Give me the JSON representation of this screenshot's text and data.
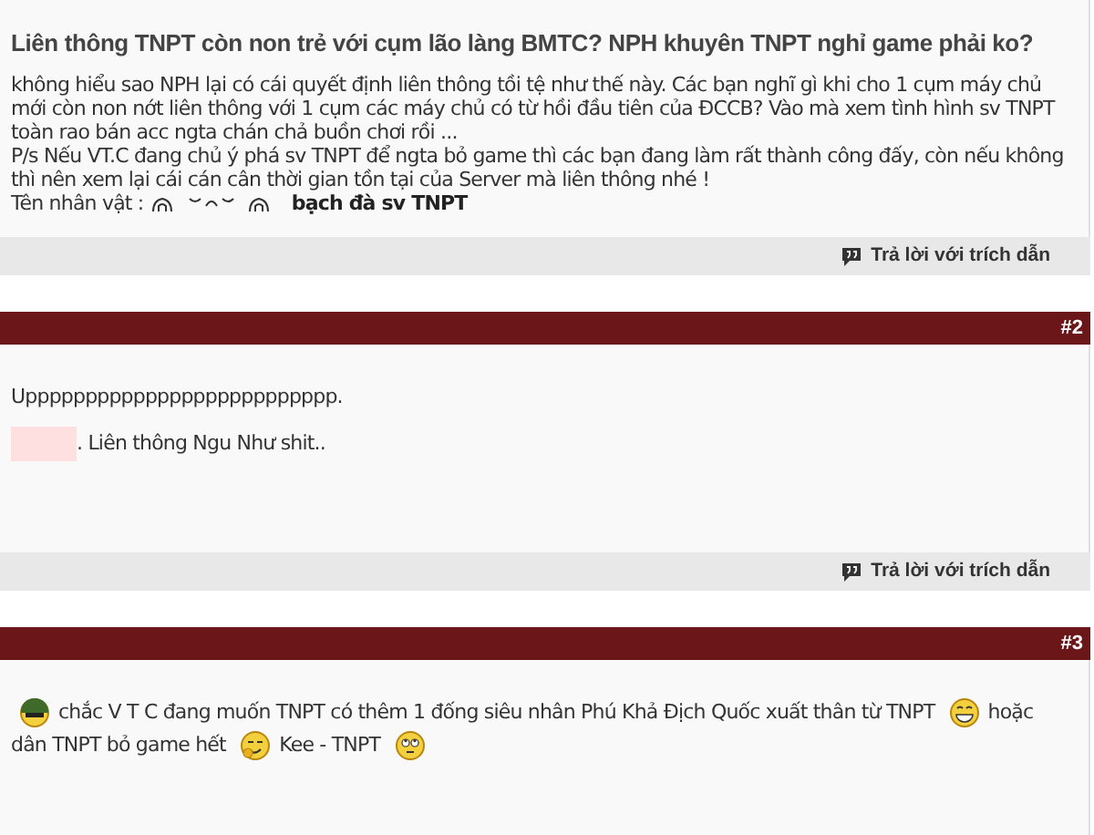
{
  "posts": [
    {
      "title": "Liên thông TNPT còn non trẻ với cụm lão làng BMTC? NPH khuyên TNPT nghỉ game phải ko?",
      "paragraphs": [
        {
          "segments": [
            {
              "kind": "text",
              "text": "không hiểu sao NPH lại có cái quyết định liên thông tồi tệ như thế này. Các bạn nghĩ gì khi cho 1 cụm máy chủ mới còn non nớt liên thông với 1 cụm các máy chủ có từ hồi đầu tiên của ĐCCB? Vào mà xem tình hình sv TNPT toàn rao bán acc ngta chán chả buồn chơi rồi ..."
            }
          ]
        },
        {
          "segments": [
            {
              "kind": "text",
              "text": "P/s Nếu VT.C đang chủ ý phá sv TNPT để ngta bỏ game thì các bạn đang làm rất thành công đấy, còn nếu không thì nên xem lại cái cán cân thời gian tồn tại của Server mà liên thông nhé !"
            }
          ]
        },
        {
          "segments": [
            {
              "kind": "text",
              "text": "Tên nhân vật :"
            },
            {
              "kind": "kaomoji"
            },
            {
              "kind": "bold",
              "text": "bạch đà sv TNPT"
            }
          ]
        }
      ],
      "reply_label": "Trả lời với trích dẫn"
    },
    {
      "number": "#2",
      "paragraphs": [
        {
          "segments": [
            {
              "kind": "text",
              "text": "Upppppppppppppppppppppppppp."
            }
          ]
        },
        {
          "segments": [
            {
              "kind": "redacted"
            },
            {
              "kind": "text",
              "text": ". Liên thông Ngu Như shit.."
            }
          ]
        }
      ],
      "reply_label": "Trả lời với trích dẫn"
    },
    {
      "number": "#3",
      "paragraphs": [
        {
          "segments": [
            {
              "kind": "helmet"
            },
            {
              "kind": "phrase",
              "text": "chắc V T C đang muốn TNPT có thêm 1 đống siêu nhân Phú Khả Địch Quốc xuất thân từ TNPT"
            },
            {
              "kind": "grin"
            },
            {
              "kind": "phrase",
              "text": "hoặc"
            },
            {
              "kind": "phrase",
              "text": "dân TNPT bỏ game hết"
            },
            {
              "kind": "giggle"
            },
            {
              "kind": "phrase",
              "text": "Kee - TNPT"
            },
            {
              "kind": "rolleyes"
            }
          ]
        }
      ]
    }
  ]
}
